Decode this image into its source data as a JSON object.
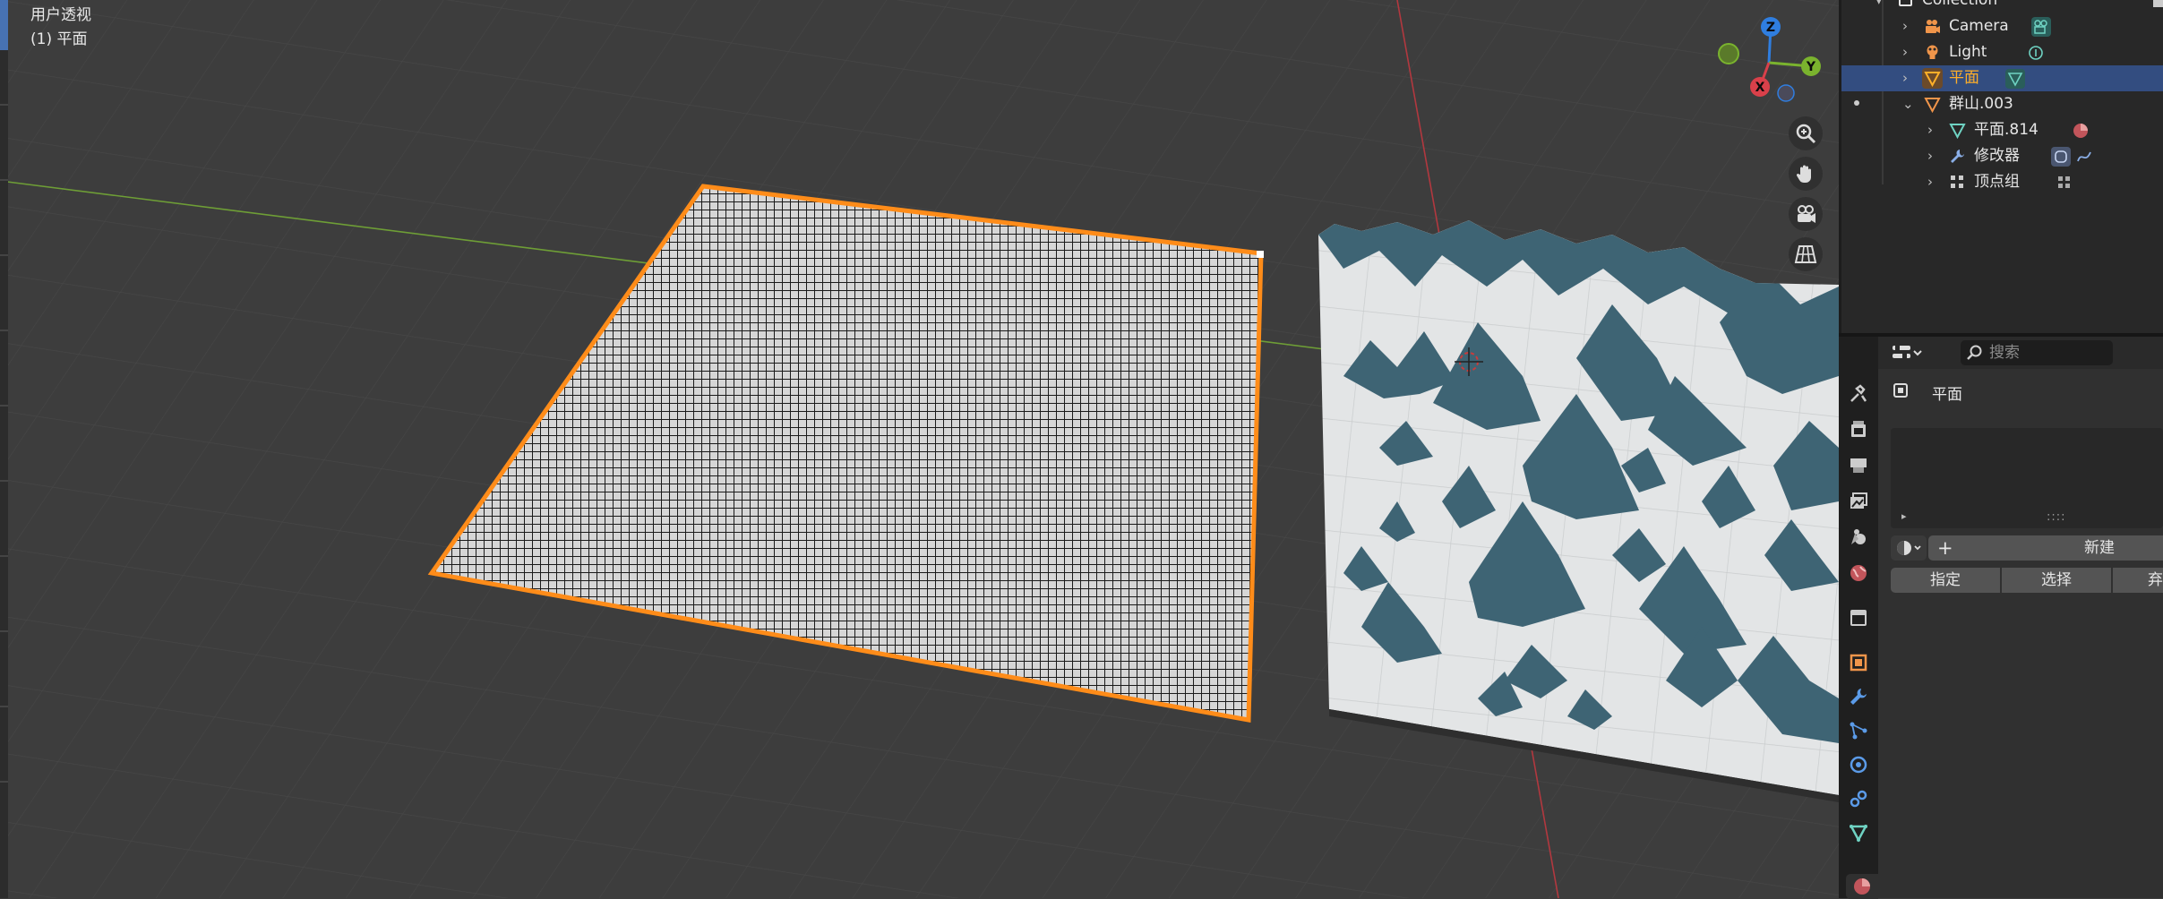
{
  "viewport": {
    "view_name": "用户透视",
    "object_info": "(1) 平面",
    "gizmo": {
      "z": "Z",
      "y": "Y",
      "x": "X"
    },
    "nav_icons": [
      "zoom-icon",
      "hand-pan-icon",
      "camera-view-icon",
      "grid-ortho-icon"
    ]
  },
  "outliner": {
    "rows": [
      {
        "label": "Collection",
        "icon": "collection-icon",
        "color": "#e6e6e6"
      },
      {
        "label": "Camera",
        "icon": "camera-icon",
        "badge": "camera-data-icon",
        "color": "#e6e6e6"
      },
      {
        "label": "Light",
        "icon": "light-icon",
        "badge": "light-data-icon",
        "color": "#e6e6e6"
      },
      {
        "label": "平面",
        "icon": "mesh-object-icon",
        "badge": "mesh-data-icon",
        "color": "#ffaf29",
        "selected": true
      },
      {
        "label": "群山.003",
        "icon": "mesh-object-icon",
        "color": "#e6e6e6",
        "expanded": true
      },
      {
        "label": "平面.814",
        "icon": "mesh-data-icon",
        "badge": "material-icon",
        "color": "#e6e6e6"
      },
      {
        "label": "修改器",
        "icon": "wrench-icon",
        "badge": "modifier-icons",
        "color": "#e6e6e6"
      },
      {
        "label": "顶点组",
        "icon": "vertex-group-icon",
        "badge": "vertex-group-data-icon",
        "color": "#e6e6e6"
      }
    ]
  },
  "properties": {
    "search_placeholder": "搜索",
    "context_label": "平面",
    "new_button": "新建",
    "assign_button": "指定",
    "select_button": "选择",
    "deselect_button": "弃",
    "tabs": [
      "tool-icon",
      "render-icon",
      "output-icon",
      "view-layer-icon",
      "scene-icon",
      "world-icon",
      "collection-icon",
      "object-icon",
      "modifier-icon",
      "particles-icon",
      "physics-icon",
      "constraints-icon",
      "data-icon",
      "material-icon"
    ]
  },
  "colors": {
    "selection_orange": "#ff8c19",
    "active_highlight": "#334d80",
    "x_axis": "#d9404a",
    "y_axis": "#7ab32e",
    "z_axis": "#2f7ee0"
  }
}
